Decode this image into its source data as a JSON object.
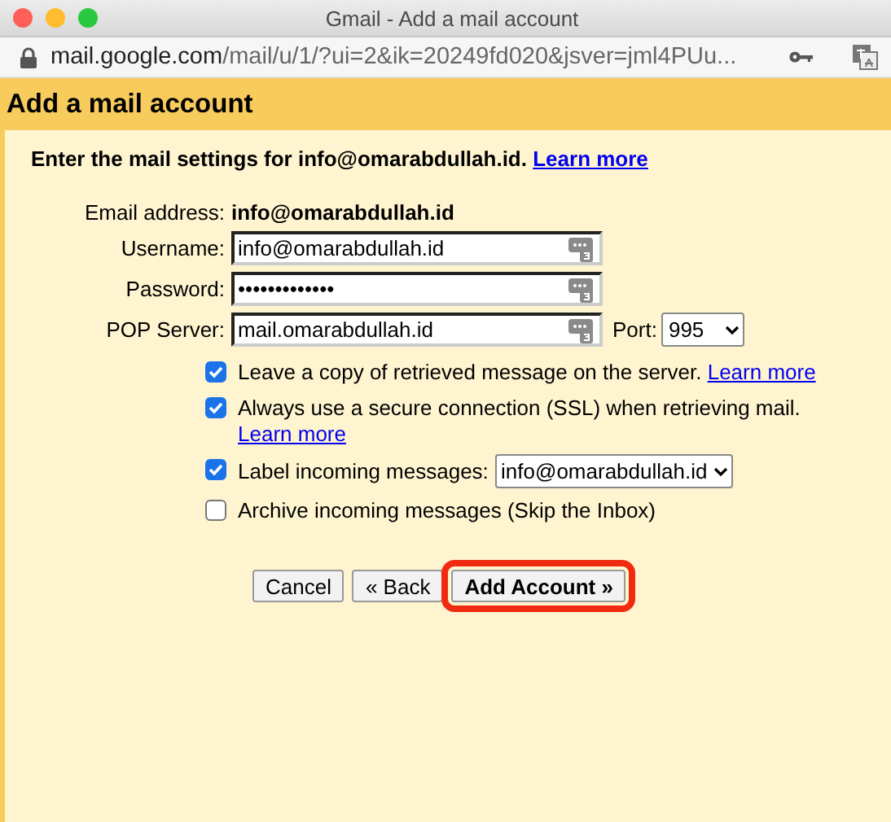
{
  "window": {
    "title": "Gmail - Add a mail account"
  },
  "address_bar": {
    "host": "mail.google.com",
    "path": "/mail/u/1/?ui=2&ik=20249fd020&jsver=jml4PUu..."
  },
  "dialog": {
    "title": "Add a mail account",
    "intro": {
      "text": "Enter the mail settings for info@omarabdullah.id.",
      "link": "Learn more"
    },
    "fields": [
      {
        "kind": "static",
        "label": "Email address:",
        "value": "info@omarabdullah.id"
      },
      {
        "kind": "text",
        "label": "Username:",
        "value": "info@omarabdullah.id"
      },
      {
        "kind": "text",
        "label": "Password:",
        "value": "•••••••••••••"
      },
      {
        "kind": "server",
        "label": "POP Server:",
        "value": "mail.omarabdullah.id",
        "port_label": "Port:",
        "port": "995"
      }
    ],
    "options": [
      {
        "label": "Leave a copy of retrieved message on the server.",
        "link": "Learn more",
        "checked": true
      },
      {
        "label": "Always use a secure connection (SSL) when retrieving mail.",
        "link": "Learn more",
        "checked": true
      },
      {
        "label": "Label incoming messages:",
        "select": "info@omarabdullah.id",
        "checked": true
      },
      {
        "label": "Archive incoming messages (Skip the Inbox)",
        "checked": false
      }
    ],
    "buttons": [
      {
        "label": "Cancel",
        "primary": false,
        "highlighted": false
      },
      {
        "label": "« Back",
        "primary": false,
        "highlighted": false
      },
      {
        "label": "Add Account »",
        "primary": true,
        "highlighted": true
      }
    ]
  }
}
